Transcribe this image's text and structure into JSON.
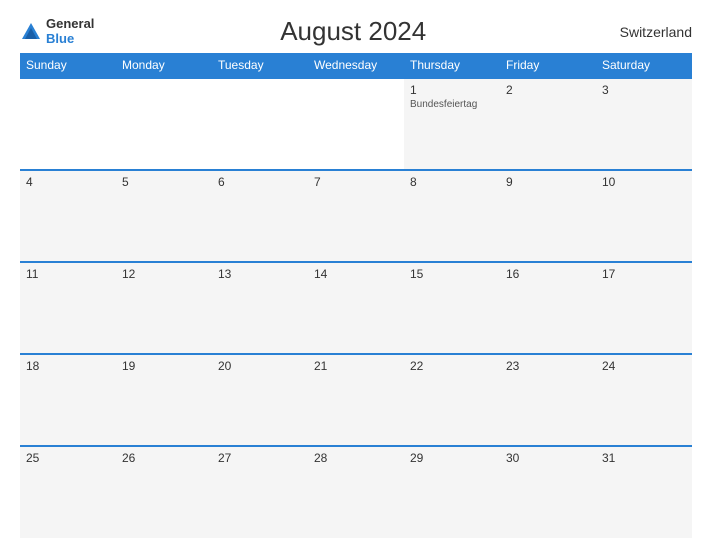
{
  "header": {
    "title": "August 2024",
    "country": "Switzerland",
    "logo_line1": "General",
    "logo_line2": "Blue"
  },
  "weekdays": [
    "Sunday",
    "Monday",
    "Tuesday",
    "Wednesday",
    "Thursday",
    "Friday",
    "Saturday"
  ],
  "weeks": [
    [
      {
        "day": "",
        "empty": true
      },
      {
        "day": "",
        "empty": true
      },
      {
        "day": "",
        "empty": true
      },
      {
        "day": "",
        "empty": true
      },
      {
        "day": "1",
        "event": "Bundesfeiertag"
      },
      {
        "day": "2",
        "event": ""
      },
      {
        "day": "3",
        "event": ""
      }
    ],
    [
      {
        "day": "4",
        "event": ""
      },
      {
        "day": "5",
        "event": ""
      },
      {
        "day": "6",
        "event": ""
      },
      {
        "day": "7",
        "event": ""
      },
      {
        "day": "8",
        "event": ""
      },
      {
        "day": "9",
        "event": ""
      },
      {
        "day": "10",
        "event": ""
      }
    ],
    [
      {
        "day": "11",
        "event": ""
      },
      {
        "day": "12",
        "event": ""
      },
      {
        "day": "13",
        "event": ""
      },
      {
        "day": "14",
        "event": ""
      },
      {
        "day": "15",
        "event": ""
      },
      {
        "day": "16",
        "event": ""
      },
      {
        "day": "17",
        "event": ""
      }
    ],
    [
      {
        "day": "18",
        "event": ""
      },
      {
        "day": "19",
        "event": ""
      },
      {
        "day": "20",
        "event": ""
      },
      {
        "day": "21",
        "event": ""
      },
      {
        "day": "22",
        "event": ""
      },
      {
        "day": "23",
        "event": ""
      },
      {
        "day": "24",
        "event": ""
      }
    ],
    [
      {
        "day": "25",
        "event": ""
      },
      {
        "day": "26",
        "event": ""
      },
      {
        "day": "27",
        "event": ""
      },
      {
        "day": "28",
        "event": ""
      },
      {
        "day": "29",
        "event": ""
      },
      {
        "day": "30",
        "event": ""
      },
      {
        "day": "31",
        "event": ""
      }
    ]
  ]
}
